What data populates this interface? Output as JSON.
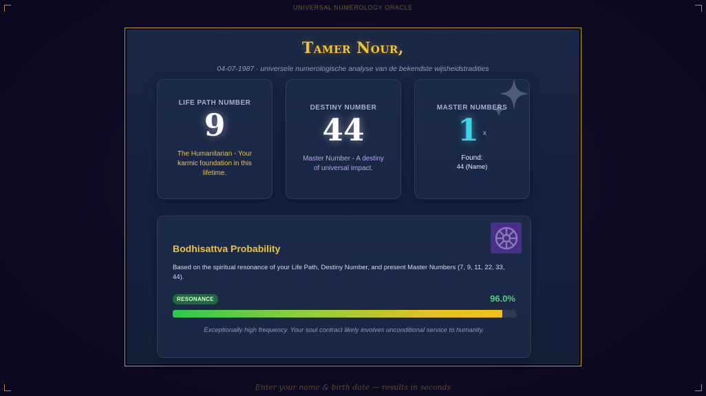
{
  "app": {
    "header": "UNIVERSAL NUMEROLOGY ORACLE",
    "footer": "Enter your name & birth date — results in seconds"
  },
  "profile": {
    "name": "Tamer Nour,",
    "subtitle": "04-07-1987 · universele numerologische analyse van de bekendste wijsheidstradities"
  },
  "cards": {
    "life_path": {
      "label": "LIFE PATH NUMBER",
      "value": "9",
      "description": "The Humanitarian - Your karmic foundation in this lifetime."
    },
    "destiny": {
      "label": "DESTINY NUMBER",
      "value": "44",
      "description": "Master Number - A destiny of universal impact."
    },
    "master": {
      "label": "MASTER NUMBERS",
      "value": "1",
      "suffix": "x",
      "found_label": "Found:",
      "found_value": "44 (Name)",
      "icon": "sparkles-icon"
    }
  },
  "bodhisattva": {
    "title": "Bodhisattva Probability",
    "description": "Based on the spiritual resonance of your Life Path, Destiny Number, and present Master Numbers (7, 9, 11, 22, 33, 44).",
    "badge": "RESONANCE",
    "percent_text": "96.0%",
    "percent_value": 96.0,
    "footer": "Exceptionally high frequency. Your soul contract likely involves unconditional service to humanity.",
    "icon": "dharma-wheel-icon"
  },
  "colors": {
    "accent_gold": "#f0c43a",
    "cyan": "#3ed3e8",
    "green": "#4fd07a",
    "frame_gold": "#c9a227"
  }
}
